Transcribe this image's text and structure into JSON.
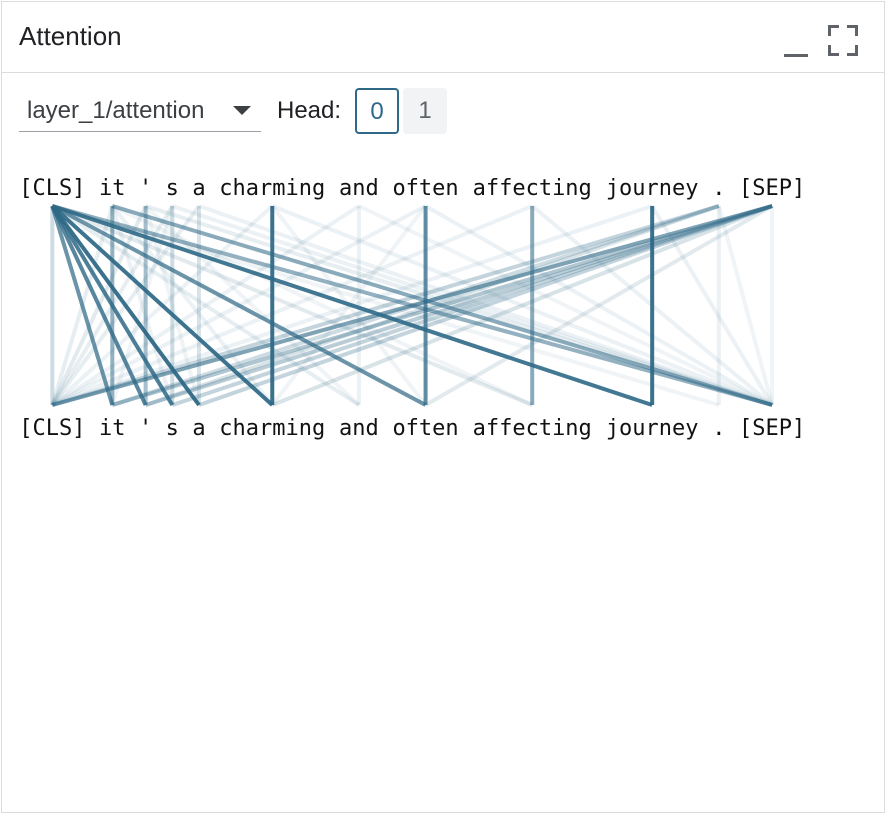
{
  "panel": {
    "title": "Attention"
  },
  "header_buttons": {
    "minimize_icon": "minimize-icon",
    "fullscreen_icon": "fullscreen-icon"
  },
  "controls": {
    "layer_select": {
      "value": "layer_1/attention",
      "icon": "dropdown-arrow-icon"
    },
    "head_label": "Head:",
    "heads": [
      {
        "label": "0",
        "selected": true
      },
      {
        "label": "1",
        "selected": false
      }
    ]
  },
  "tokens": [
    "[CLS]",
    "it",
    "'",
    "s",
    "a",
    "charming",
    "and",
    "often",
    "affecting",
    "journey",
    ".",
    "[SEP]"
  ],
  "attention": {
    "line_color": "#2f6987",
    "links": [
      [
        0,
        0,
        0.25
      ],
      [
        0,
        1,
        0.75
      ],
      [
        0,
        2,
        0.85
      ],
      [
        0,
        3,
        0.9
      ],
      [
        0,
        4,
        1.0
      ],
      [
        0,
        5,
        0.98
      ],
      [
        0,
        7,
        0.75
      ],
      [
        0,
        9,
        0.95
      ],
      [
        0,
        11,
        0.55
      ],
      [
        0,
        6,
        0.12
      ],
      [
        0,
        8,
        0.15
      ],
      [
        0,
        10,
        0.08
      ],
      [
        1,
        1,
        0.55
      ],
      [
        1,
        11,
        0.6
      ],
      [
        1,
        0,
        0.12
      ],
      [
        1,
        3,
        0.1
      ],
      [
        1,
        5,
        0.1
      ],
      [
        1,
        8,
        0.08
      ],
      [
        2,
        2,
        0.45
      ],
      [
        2,
        0,
        0.15
      ],
      [
        2,
        11,
        0.12
      ],
      [
        2,
        4,
        0.08
      ],
      [
        2,
        6,
        0.08
      ],
      [
        3,
        3,
        0.25
      ],
      [
        3,
        0,
        0.12
      ],
      [
        3,
        11,
        0.1
      ],
      [
        3,
        1,
        0.08
      ],
      [
        4,
        4,
        0.2
      ],
      [
        4,
        0,
        0.12
      ],
      [
        4,
        11,
        0.1
      ],
      [
        5,
        5,
        1.0
      ],
      [
        5,
        0,
        0.1
      ],
      [
        5,
        11,
        0.1
      ],
      [
        5,
        7,
        0.08
      ],
      [
        6,
        6,
        0.1
      ],
      [
        6,
        0,
        0.1
      ],
      [
        6,
        11,
        0.08
      ],
      [
        7,
        7,
        0.8
      ],
      [
        7,
        0,
        0.1
      ],
      [
        7,
        11,
        0.1
      ],
      [
        7,
        5,
        0.08
      ],
      [
        8,
        8,
        0.6
      ],
      [
        8,
        0,
        0.1
      ],
      [
        8,
        11,
        0.1
      ],
      [
        9,
        9,
        1.0
      ],
      [
        9,
        0,
        0.1
      ],
      [
        9,
        11,
        0.1
      ],
      [
        10,
        0,
        0.3
      ],
      [
        10,
        1,
        0.25
      ],
      [
        10,
        2,
        0.2
      ],
      [
        10,
        10,
        0.1
      ],
      [
        10,
        11,
        0.08
      ],
      [
        11,
        0,
        0.65
      ],
      [
        11,
        1,
        0.4
      ],
      [
        11,
        2,
        0.35
      ],
      [
        11,
        3,
        0.3
      ],
      [
        11,
        4,
        0.3
      ],
      [
        11,
        5,
        0.2
      ],
      [
        11,
        7,
        0.15
      ],
      [
        11,
        11,
        0.08
      ]
    ]
  }
}
